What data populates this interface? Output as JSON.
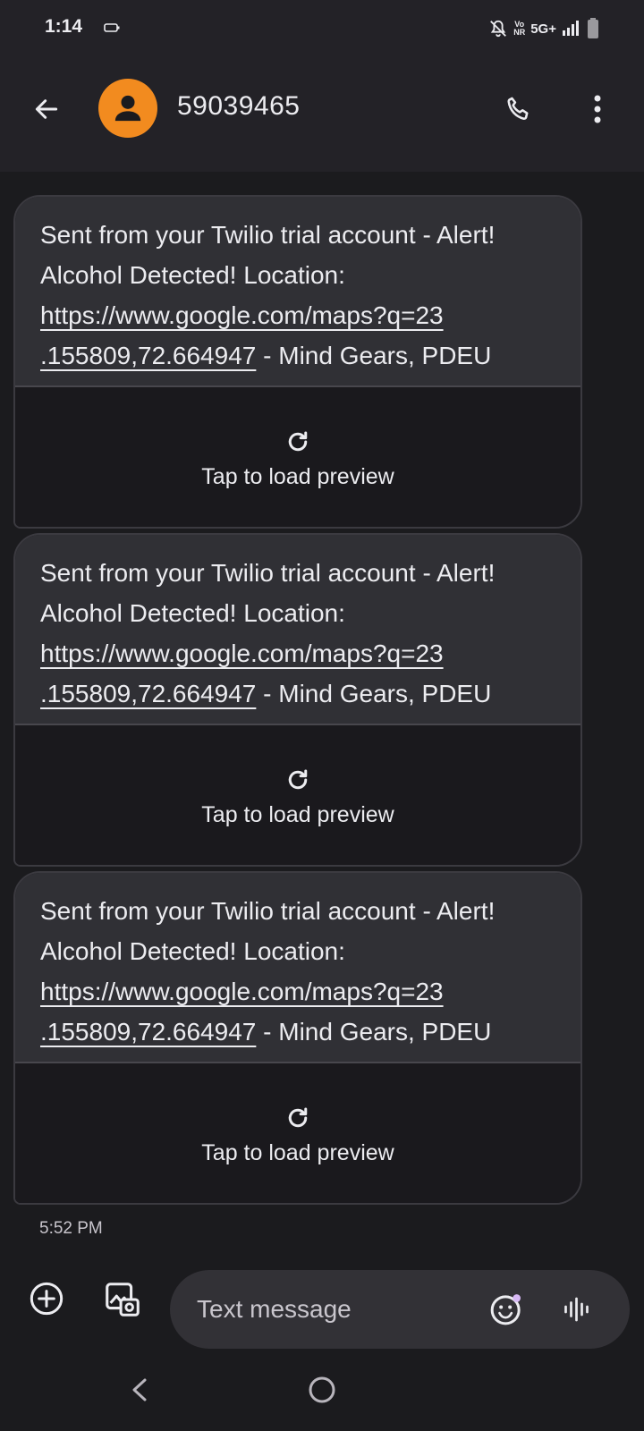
{
  "status_bar": {
    "time": "1:14",
    "network": "5G+",
    "volte_top": "Vo",
    "volte_bottom": "NR",
    "icons": [
      "battery-saver-icon",
      "mute-notifications-icon",
      "signal-icon",
      "battery-icon"
    ]
  },
  "header": {
    "contact_name": "59039465",
    "avatar_color": "#f28b1f",
    "icons": [
      "back-arrow-icon",
      "person-icon",
      "phone-icon",
      "more-vert-icon"
    ]
  },
  "messages": [
    {
      "text_before_link": "Sent from your Twilio trial account - Alert! Alcohol Detected! Location: ",
      "link_line1": "https://www.google.com/maps?q=23",
      "link_line2": ".155809,72.664947",
      "text_after_link": " - Mind Gears, PDEU",
      "preview_label": "Tap to load preview"
    },
    {
      "text_before_link": "Sent from your Twilio trial account - Alert! Alcohol Detected! Location: ",
      "link_line1": "https://www.google.com/maps?q=23",
      "link_line2": ".155809,72.664947",
      "text_after_link": " - Mind Gears, PDEU",
      "preview_label": "Tap to load preview"
    },
    {
      "text_before_link": "Sent from your Twilio trial account - Alert! Alcohol Detected! Location: ",
      "link_line1": "https://www.google.com/maps?q=23",
      "link_line2": ".155809,72.664947",
      "text_after_link": " - Mind Gears, PDEU",
      "preview_label": "Tap to load preview"
    }
  ],
  "timestamp": "5:52 PM",
  "composer": {
    "placeholder": "Text message",
    "icons": [
      "add-icon",
      "gallery-icon",
      "emoji-icon",
      "voice-icon"
    ]
  },
  "nav": {
    "icons": [
      "nav-back-icon",
      "nav-home-icon"
    ]
  }
}
